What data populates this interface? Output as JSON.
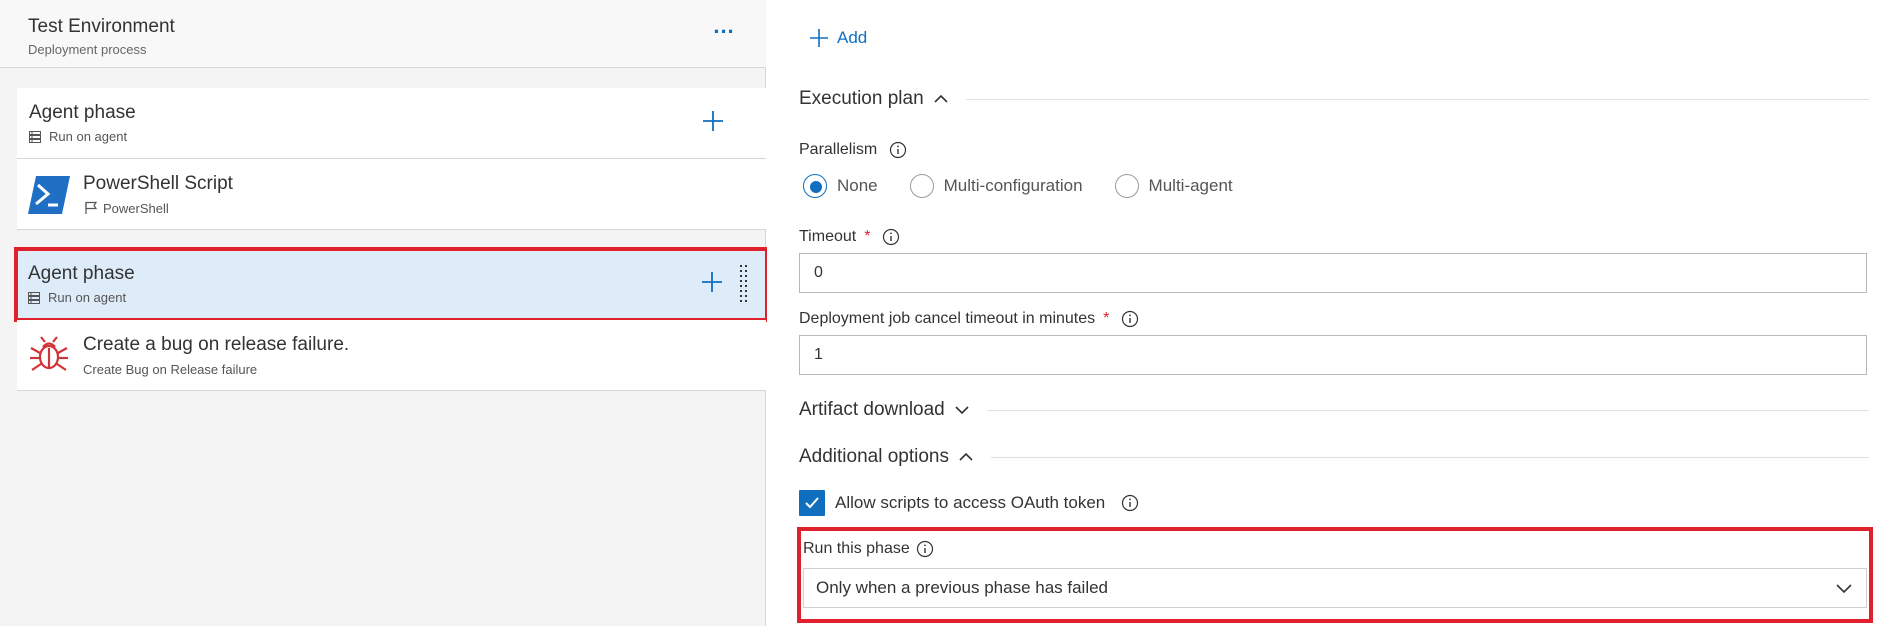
{
  "environment": {
    "title": "Test Environment",
    "subtitle": "Deployment process",
    "more_label": "..."
  },
  "phases": [
    {
      "title": "Agent phase",
      "subtitle": "Run on agent",
      "tasks": [
        {
          "title": "PowerShell Script",
          "subtitle": "PowerShell",
          "icon": "powershell-icon"
        }
      ]
    },
    {
      "title": "Agent phase",
      "subtitle": "Run on agent",
      "selected": true,
      "tasks": [
        {
          "title": "Create a bug on release failure.",
          "subtitle": "Create Bug on Release failure",
          "icon": "bug-icon"
        }
      ]
    }
  ],
  "details": {
    "add_label": "Add",
    "execution_plan": {
      "heading": "Execution plan",
      "parallelism_label": "Parallelism",
      "parallelism_options": [
        "None",
        "Multi-configuration",
        "Multi-agent"
      ],
      "parallelism_selected": "None",
      "timeout_label": "Timeout",
      "timeout_value": "0",
      "cancel_timeout_label": "Deployment job cancel timeout in minutes",
      "cancel_timeout_value": "1",
      "required_mark": "*"
    },
    "artifact_download": {
      "heading": "Artifact download"
    },
    "additional_options": {
      "heading": "Additional options",
      "oauth_label": "Allow scripts to access OAuth token",
      "oauth_checked": true,
      "run_phase_label": "Run this phase",
      "run_phase_value": "Only when a previous phase has failed"
    }
  },
  "colors": {
    "accent": "#106ebe",
    "highlight": "#e0202c",
    "selected_row": "#deecf9",
    "powershell_blue": "#1f6fc5",
    "bug_red": "#d13438"
  }
}
